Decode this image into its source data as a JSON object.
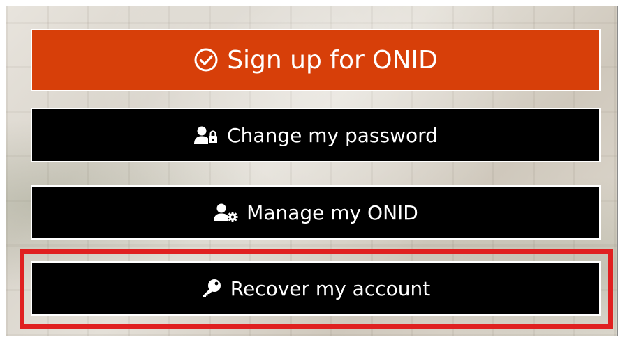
{
  "buttons": {
    "signup": {
      "label": "Sign up for ONID",
      "icon": "check-circle-icon"
    },
    "change_password": {
      "label": "Change my password",
      "icon": "user-lock-icon"
    },
    "manage_onid": {
      "label": "Manage my ONID",
      "icon": "user-gear-icon"
    },
    "recover_account": {
      "label": "Recover my account",
      "icon": "key-icon"
    }
  },
  "colors": {
    "signup_bg": "#d73f09",
    "button_bg": "#000000",
    "highlight": "#e02020",
    "text": "#ffffff"
  }
}
